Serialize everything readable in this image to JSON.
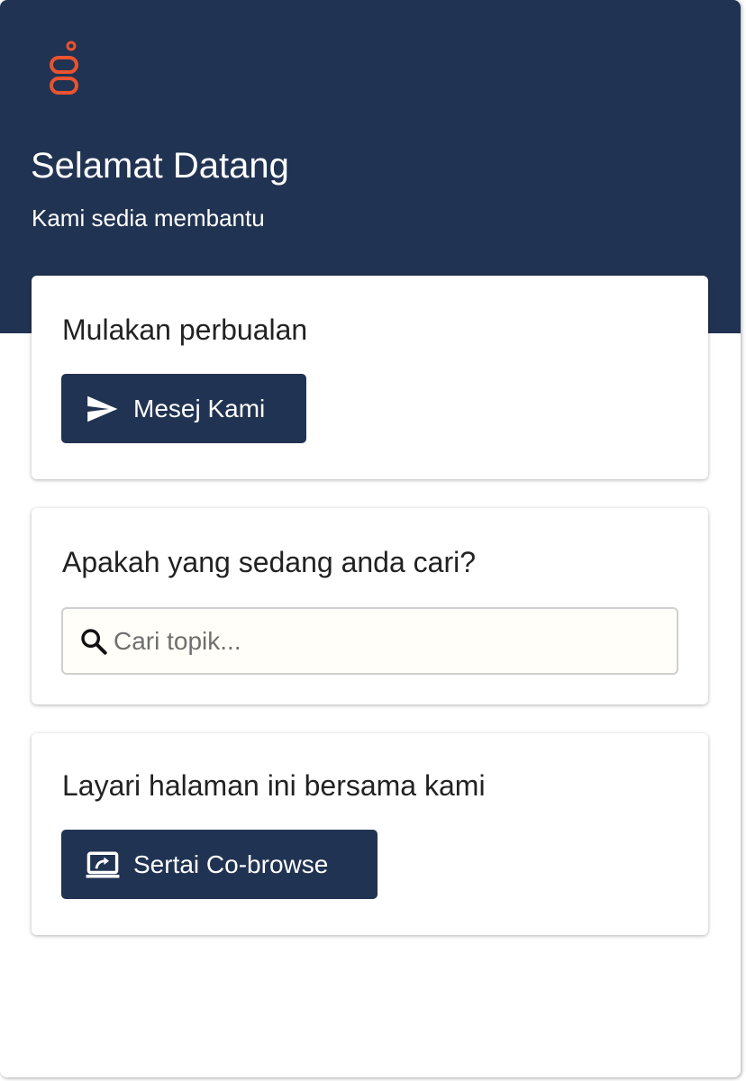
{
  "header": {
    "logo_icon": "genesys-logo-icon",
    "title": "Selamat Datang",
    "subtitle": "Kami sedia membantu",
    "background_color": "#213352",
    "logo_color": "#e9532f"
  },
  "message_card": {
    "title": "Mulakan perbualan",
    "button_label": "Mesej Kami",
    "button_icon": "send-icon"
  },
  "search_card": {
    "title": "Apakah yang sedang anda cari?",
    "search_placeholder": "Cari topik...",
    "search_value": "",
    "search_icon": "search-icon"
  },
  "cobrowse_card": {
    "title": "Layari halaman ini bersama kami",
    "button_label": "Sertai Co-browse",
    "button_icon": "cobrowse-screen-icon"
  }
}
